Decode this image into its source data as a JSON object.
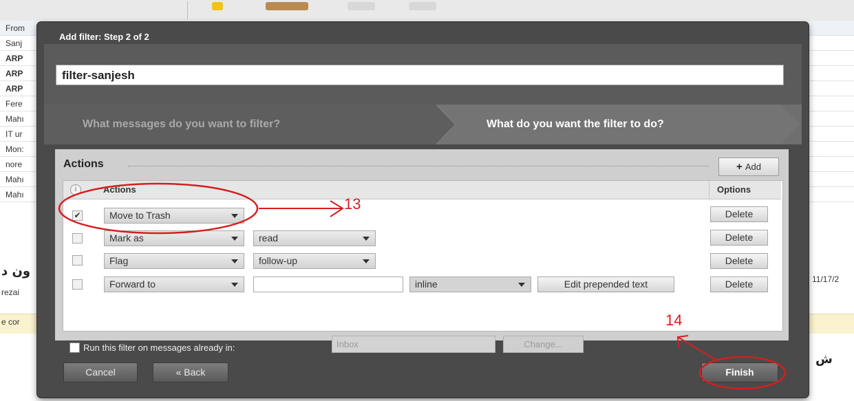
{
  "background": {
    "list_rows": [
      "From",
      "Sanj",
      "ARP",
      "ARP",
      "ARP",
      "Fere",
      "Mahı",
      "IT ur",
      "Mon:",
      "nore",
      "Mahı",
      "Mahı"
    ],
    "arabic_left": "ون د",
    "email_fragment": "rezai",
    "compose_fragment": "e cor",
    "date_fragment": "11/17/2",
    "arabic_right": "ش"
  },
  "dialog": {
    "title": "Add filter: Step 2 of 2",
    "filter_name": "filter-sanjesh",
    "step1_label": "What messages do you want to filter?",
    "step2_label": "What do you want the filter to do?",
    "section_heading": "Actions",
    "add_label": "Add",
    "table_header": {
      "actions": "Actions",
      "options": "Options"
    },
    "rows": [
      {
        "checked": true,
        "action": "Move to Trash",
        "value": "",
        "extra": "",
        "extra_button": "",
        "delete": "Delete"
      },
      {
        "checked": false,
        "action": "Mark as",
        "value": "read",
        "extra": "",
        "extra_button": "",
        "delete": "Delete"
      },
      {
        "checked": false,
        "action": "Flag",
        "value": "follow-up",
        "extra": "",
        "extra_button": "",
        "delete": "Delete"
      },
      {
        "checked": false,
        "action": "Forward to",
        "value": "",
        "extra": "inline",
        "extra_button": "Edit prepended text",
        "delete": "Delete"
      }
    ],
    "run_label": "Run this filter on messages already in:",
    "run_folder": "Inbox",
    "change_label": "Change...",
    "cancel_label": "Cancel",
    "back_label": "« Back",
    "finish_label": "Finish"
  },
  "annotations": {
    "label_13": "13",
    "label_14": "14",
    "color": "#d41f1f"
  }
}
